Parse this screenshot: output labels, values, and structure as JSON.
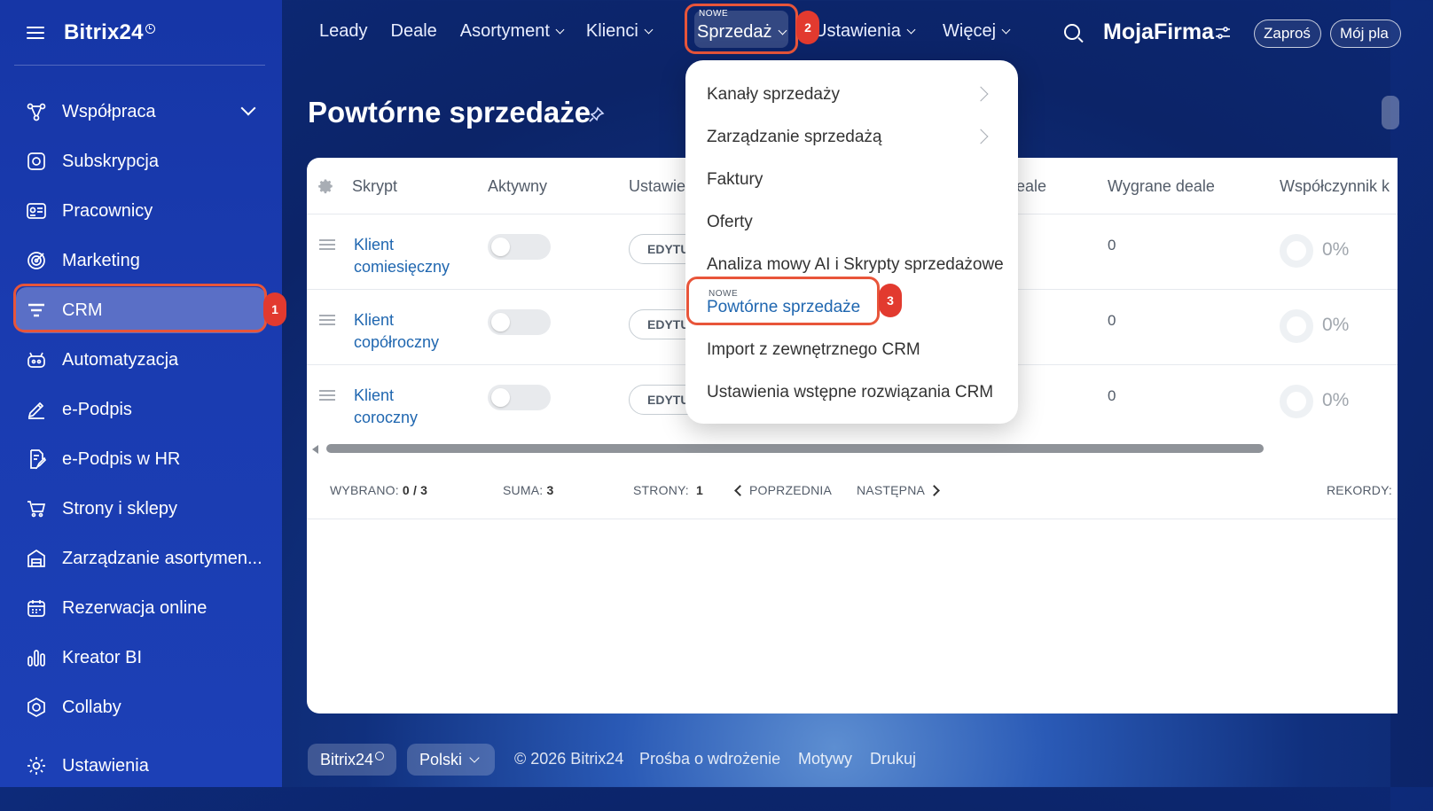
{
  "sidebar": {
    "logo": "Bitrix24",
    "items": [
      {
        "label": "Współpraca",
        "icon": "collaboration-icon"
      },
      {
        "label": "Subskrypcja",
        "icon": "subscription-icon"
      },
      {
        "label": "Pracownicy",
        "icon": "employees-icon"
      },
      {
        "label": "Marketing",
        "icon": "marketing-icon"
      },
      {
        "label": "CRM",
        "icon": "crm-icon"
      },
      {
        "label": "Automatyzacja",
        "icon": "automation-icon"
      },
      {
        "label": "e-Podpis",
        "icon": "esign-icon"
      },
      {
        "label": "e-Podpis w HR",
        "icon": "esign-hr-icon"
      },
      {
        "label": "Strony i sklepy",
        "icon": "cart-icon"
      },
      {
        "label": "Zarządzanie asortymen...",
        "icon": "warehouse-icon"
      },
      {
        "label": "Rezerwacja online",
        "icon": "calendar-icon"
      },
      {
        "label": "Kreator BI",
        "icon": "chart-icon"
      },
      {
        "label": "Collaby",
        "icon": "collaby-icon"
      },
      {
        "label": "Ustawienia",
        "icon": "gear-icon"
      }
    ]
  },
  "badges": {
    "b1": "1",
    "b2": "2",
    "b3": "3"
  },
  "topnav": {
    "items": [
      "Leady",
      "Deale",
      "Asortyment",
      "Klienci"
    ],
    "sprzedaz_new": "NOWE",
    "sprzedaz": "Sprzedaż",
    "ustawienia": "Ustawienia",
    "wiecej": "Więcej",
    "company": "MojaFirma",
    "invite": "Zaproś",
    "plan": "Mój pla"
  },
  "page": {
    "title": "Powtórne sprzedaże"
  },
  "table": {
    "headers": {
      "script": "Skrypt",
      "active": "Aktywny",
      "settings": "Ustawie",
      "deals": "eale",
      "won": "Wygrane deale",
      "ratio": "Współczynnik k"
    },
    "rows": [
      {
        "line1": "Klient",
        "line2": "comiesięczny",
        "edit": "EDYTUJ",
        "won": "0",
        "ratio": "0%"
      },
      {
        "line1": "Klient",
        "line2": "copółroczny",
        "edit": "EDYTUJ",
        "won": "0",
        "ratio": "0%"
      },
      {
        "line1": "Klient",
        "line2": "coroczny",
        "edit": "EDYTUJ",
        "won": "0",
        "ratio": "0%"
      }
    ],
    "footer": {
      "selected_label": "WYBRANO:",
      "selected_value": "0 / 3",
      "sum_label": "SUMA:",
      "sum_value": "3",
      "pages_label": "STRONY:",
      "pages_value": "1",
      "prev": "POPRZEDNIA",
      "next": "NASTĘPNA",
      "records": "REKORDY:"
    }
  },
  "dropdown": {
    "items": [
      "Kanały sprzedaży",
      "Zarządzanie sprzedażą",
      "Faktury",
      "Oferty",
      "Analiza mowy AI i Skrypty sprzedażowe"
    ],
    "active_new": "NOWE",
    "active": "Powtórne sprzedaże",
    "after": [
      "Import z zewnętrznego CRM",
      "Ustawienia wstępne rozwiązania CRM"
    ]
  },
  "footer": {
    "brand": "Bitrix24",
    "language": "Polski",
    "copyright": "© 2026 Bitrix24",
    "links": [
      "Prośba o wdrożenie",
      "Motywy",
      "Drukuj"
    ]
  },
  "colors": {
    "accent": "#2067b0",
    "highlight": "#e8553a",
    "badge": "#e23a2f",
    "sidebar": "#1a3bb0"
  }
}
